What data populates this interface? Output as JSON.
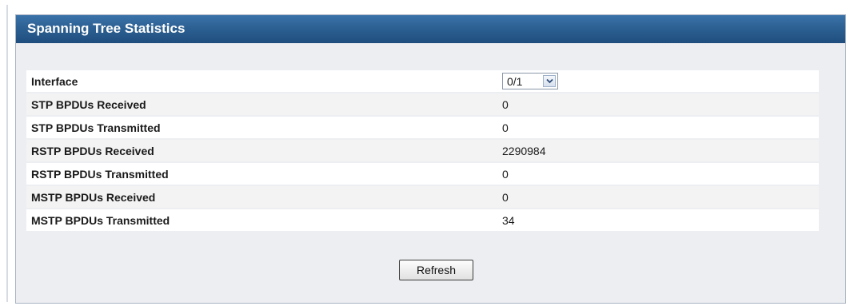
{
  "panel": {
    "title": "Spanning Tree Statistics"
  },
  "interface": {
    "label": "Interface",
    "selected": "0/1"
  },
  "stats": [
    {
      "label": "STP BPDUs Received",
      "value": "0"
    },
    {
      "label": "STP BPDUs Transmitted",
      "value": "0"
    },
    {
      "label": "RSTP BPDUs Received",
      "value": "2290984"
    },
    {
      "label": "RSTP BPDUs Transmitted",
      "value": "0"
    },
    {
      "label": "MSTP BPDUs Received",
      "value": "0"
    },
    {
      "label": "MSTP BPDUs Transmitted",
      "value": "34"
    }
  ],
  "actions": {
    "refresh_label": "Refresh"
  },
  "colors": {
    "header": "#2b5f92",
    "panel_background": "#eceef1",
    "row_background": "#ffffff",
    "row_alt_background": "#f3f3f3"
  },
  "icons": {
    "dropdown": "chevron-down-icon"
  }
}
